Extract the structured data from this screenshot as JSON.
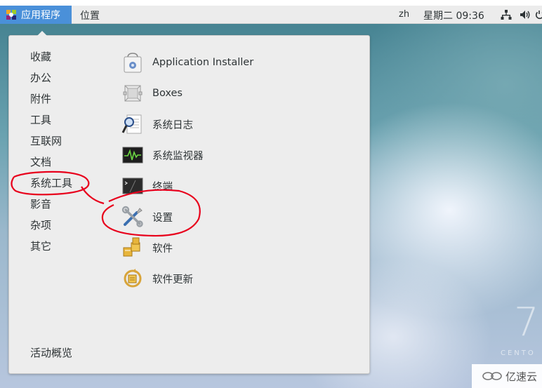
{
  "topbar": {
    "applications_label": "应用程序",
    "places_label": "位置",
    "language": "zh",
    "clock": "星期二 09:36",
    "tray_icons": [
      "network-icon",
      "volume-icon",
      "power-icon"
    ]
  },
  "menu": {
    "categories": [
      "收藏",
      "办公",
      "附件",
      "工具",
      "互联网",
      "文档",
      "系统工具",
      "影音",
      "杂项",
      "其它"
    ],
    "selected_category": "系统工具",
    "apps": [
      {
        "label": "Application Installer",
        "icon": "application-installer-icon"
      },
      {
        "label": "Boxes",
        "icon": "boxes-icon"
      },
      {
        "label": "系统日志",
        "icon": "system-log-icon"
      },
      {
        "label": "系统监视器",
        "icon": "system-monitor-icon"
      },
      {
        "label": "终端",
        "icon": "terminal-icon"
      },
      {
        "label": "设置",
        "icon": "settings-icon"
      },
      {
        "label": "软件",
        "icon": "software-icon"
      },
      {
        "label": "软件更新",
        "icon": "software-update-icon"
      }
    ],
    "overview_label": "活动概览"
  },
  "desktop": {
    "version_mark": "7",
    "distro_text": "CENTO"
  },
  "watermark": {
    "text": "亿速云"
  },
  "colors": {
    "accent": "#4a90d9",
    "annotation": "#e8001c"
  }
}
